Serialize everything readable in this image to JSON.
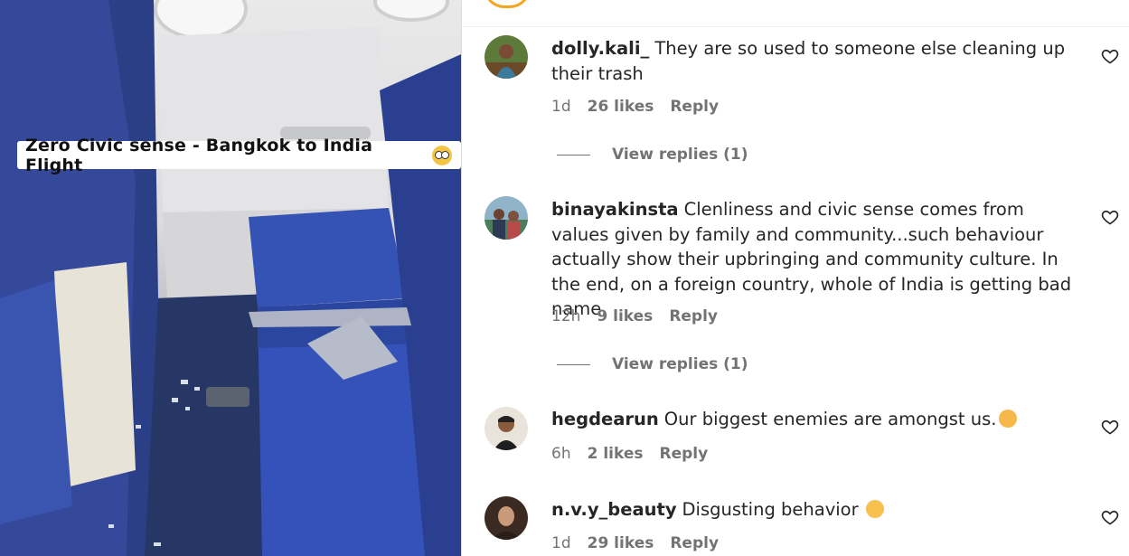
{
  "post": {
    "caption_text": "Zero Civic sense - Bangkok to India Flight",
    "caption_emoji": "rolling-eyes-emoji"
  },
  "comments": [
    {
      "username": "dolly.kali_",
      "text": "They are so used to someone else cleaning up their trash",
      "time": "1d",
      "likes": "26 likes",
      "reply": "Reply",
      "view_replies": "View replies (1)"
    },
    {
      "username": "binayakinsta",
      "text": "Clenliness and civic sense comes from values given by family and community...such behaviour actually show their upbringing and community culture. In the end, on a foreign country, whole of India is getting bad name.",
      "time": "12h",
      "likes": "9 likes",
      "reply": "Reply",
      "view_replies": "View replies (1)"
    },
    {
      "username": "hegdearun",
      "text": "Our biggest enemies are amongst us.",
      "emoji": "relieved-face-emoji",
      "time": "6h",
      "likes": "2 likes",
      "reply": "Reply"
    },
    {
      "username": "n.v.y_beauty",
      "text": "Disgusting behavior",
      "emoji": "flushed-face-emoji",
      "time": "1d",
      "likes": "29 likes",
      "reply": "Reply"
    }
  ],
  "icons": {
    "like": "heart-outline-icon"
  },
  "colors": {
    "seat_blue": "#2f48a8",
    "text_primary": "#262626",
    "text_secondary": "#737373"
  }
}
